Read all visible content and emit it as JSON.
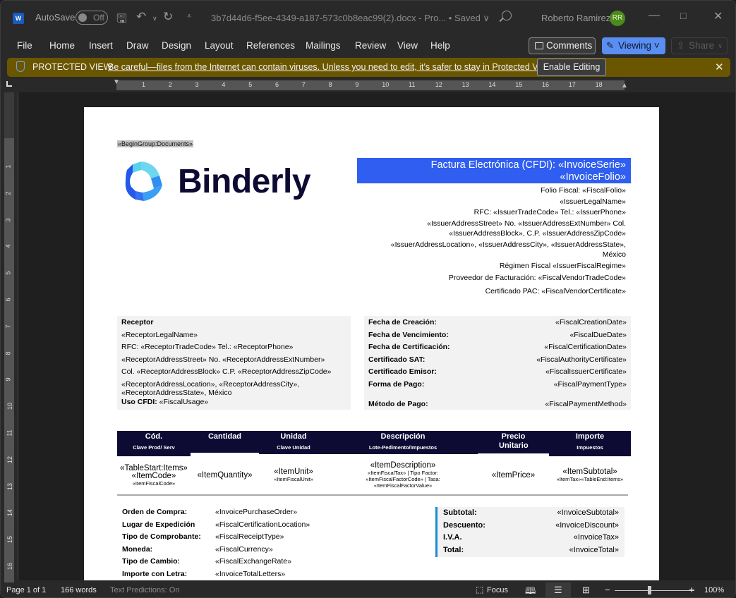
{
  "titlebar": {
    "app_icon": "word-icon",
    "autosave_label": "AutoSave",
    "autosave_state": "Off",
    "document_title": "3b7d44d6-f5ee-4349-a187-573c0b8eac99(2).docx  -  Pro...  • Saved ∨",
    "user_name": "Roberto Ramirez",
    "user_initials": "RR"
  },
  "menu": {
    "items": [
      "File",
      "Home",
      "Insert",
      "Draw",
      "Design",
      "Layout",
      "References",
      "Mailings",
      "Review",
      "View",
      "Help"
    ],
    "comments_label": "Comments",
    "viewing_label": "Viewing ˅",
    "share_label": "Share"
  },
  "protected_view": {
    "title": "PROTECTED VIEW",
    "message": "Be careful—files from the Internet can contain viruses. Unless you need to edit, it's safer to stay in Protected View.",
    "enable_label": "Enable Editing"
  },
  "ruler": {
    "h_numbers": [
      "1",
      "2",
      "3",
      "4",
      "5",
      "6",
      "7",
      "8",
      "9",
      "10",
      "11",
      "12",
      "13",
      "14",
      "15",
      "16",
      "17",
      "18"
    ],
    "v_numbers": [
      "1",
      "2",
      "3",
      "4",
      "5",
      "6",
      "7",
      "8",
      "9",
      "10",
      "11",
      "12",
      "13",
      "14",
      "15",
      "16"
    ]
  },
  "document": {
    "begin_group": "«BeginGroup:Documents»",
    "brand_name": "Binderly",
    "invoice_title_line1": "Factura Electrónica (CFDI): «InvoiceSerie»",
    "invoice_title_line2": "«InvoiceFolio»",
    "issuer_lines": [
      "Folio Fiscal: «FiscalFolio»",
      "«IssuerLegalName»",
      "RFC: «IssuerTradeCode» Tel.: «IssuerPhone»",
      "«IssuerAddressStreet» No. «IssuerAddressExtNumber» Col.",
      "«IssuerAddressBlock», C.P. «IssuerAddressZipCode»",
      "«IssuerAddressLocation», «IssuerAddressCity», «IssuerAddressState»,",
      "México",
      "Régimen Fiscal «IssuerFiscalRegime»",
      "Proveedor de Facturación: «FiscalVendorTradeCode»",
      "Certificado PAC: «FiscalVendorCertificate»"
    ],
    "receptor": {
      "heading": "Receptor",
      "lines": [
        "«ReceptorLegalName»",
        "RFC: «ReceptorTradeCode» Tel.: «ReceptorPhone»",
        "«ReceptorAddressStreet» No. «ReceptorAddressExtNumber»",
        "Col. «ReceptorAddressBlock» C.P. «ReceptorAddressZipCode»",
        "«ReceptorAddressLocation», «ReceptorAddressCity»,",
        "«ReceptorAddressState», México"
      ],
      "usage_label": "Uso CFDI:",
      "usage_value": " «FiscalUsage»"
    },
    "fiscal": [
      {
        "label": "Fecha de Creación:",
        "value": "«FiscalCreationDate»"
      },
      {
        "label": "Fecha de Vencimiento:",
        "value": "«FiscalDueDate»"
      },
      {
        "label": "Fecha de Certificación:",
        "value": "«FiscalCertificationDate»"
      },
      {
        "label": "Certificado SAT:",
        "value": "«FiscalAuthorityCertificate»"
      },
      {
        "label": "Certificado Emisor:",
        "value": "«FiscalIssuerCertificate»"
      },
      {
        "label": "Forma de Pago:",
        "value": "«FiscalPaymentType»"
      },
      {
        "label": "Método de Pago:",
        "value": "«FiscalPaymentMethod»"
      }
    ],
    "items_table": {
      "headers": [
        {
          "title": "Cód.",
          "sub": "Clave Prod/ Serv"
        },
        {
          "title": "Cantidad",
          "sub": ""
        },
        {
          "title": "Unidad",
          "sub": "Clave Unidad"
        },
        {
          "title": "Descripción",
          "sub": "Lote-Pedimento/Impuestos"
        },
        {
          "title": "Precio Unitario",
          "sub": ""
        },
        {
          "title": "Importe",
          "sub": "Impuestos"
        }
      ],
      "row": {
        "code_main": "«TableStart:Items» «ItemCode»",
        "code_sub": "«ItemFiscalCode»",
        "quantity": "«ItemQuantity»",
        "unit_main": "«ItemUnit»",
        "unit_sub": "«ItemFiscalUnit»",
        "desc_main": "«ItemDescription»",
        "desc_sub": "«ItemFiscalTax» | Tipo Factor: «ItemFiscalFactorCode» | Tasa: «ItemFiscalFactorValue»",
        "price": "«ItemPrice»",
        "subtotal_main": "«ItemSubtotal»",
        "subtotal_sub": "«ItemTax»«TableEnd:Items»"
      }
    },
    "extra": [
      {
        "label": "Orden de Compra:",
        "value": "«InvoicePurchaseOrder»"
      },
      {
        "label": "Lugar de Expedición",
        "value": "«FiscalCertificationLocation»"
      },
      {
        "label": "Tipo de Comprobante:",
        "value": "«FiscalReceiptType»"
      },
      {
        "label": "Moneda:",
        "value": "«FiscalCurrency»"
      },
      {
        "label": "Tipo de Cambio:",
        "value": "«FiscalExchangeRate»"
      },
      {
        "label": "Importe con Letra:",
        "value": "«InvoiceTotalLetters»"
      }
    ],
    "totals": [
      {
        "label": "Subtotal:",
        "value": "«InvoiceSubtotal»"
      },
      {
        "label": "Descuento:",
        "value": "«InvoiceDiscount»"
      },
      {
        "label": "I.V.A.",
        "value": "«InvoiceTax»"
      },
      {
        "label": "Total:",
        "value": "«InvoiceTotal»"
      }
    ]
  },
  "status": {
    "page": "Page 1 of 1",
    "words": "166 words",
    "predictions": "Text Predictions: On",
    "focus_label": "Focus",
    "zoom_minus": "−",
    "zoom_plus": "+",
    "zoom_level": "100%",
    "zoom_percent": 100
  },
  "colors": {
    "title_bar_bg": "#2f5ef0",
    "table_header_bg": "#0d0b33",
    "protected_bar_bg": "#6b5600",
    "viewing_button": "#5a8ef0",
    "totals_accent": "#1a8bd0"
  }
}
